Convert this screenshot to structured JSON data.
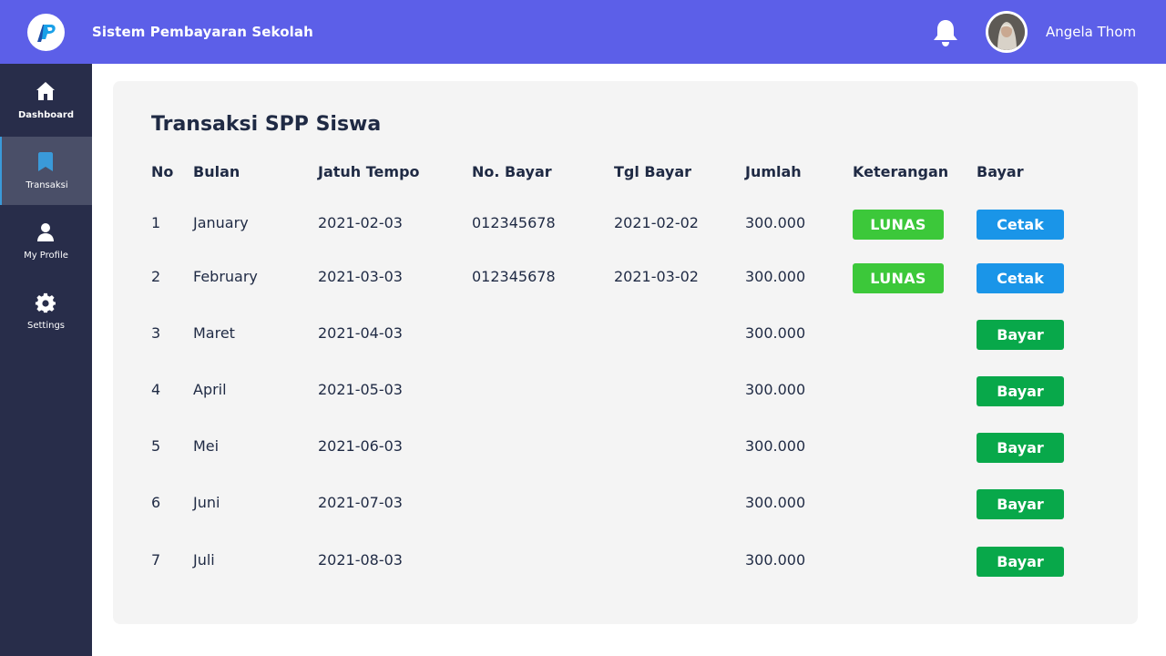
{
  "header": {
    "app_title": "Sistem Pembayaran Sekolah",
    "user_name": "Angela Thom",
    "icons": {
      "logo": "app-logo",
      "bell": "bell-icon",
      "avatar": "user-avatar"
    }
  },
  "sidebar": {
    "items": [
      {
        "label": "Dashboard",
        "icon": "home-icon",
        "active": false
      },
      {
        "label": "Transaksi",
        "icon": "bookmark-icon",
        "active": true
      },
      {
        "label": "My Profile",
        "icon": "user-icon",
        "active": false
      },
      {
        "label": "Settings",
        "icon": "gear-icon",
        "active": false
      }
    ]
  },
  "main": {
    "title": "Transaksi SPP Siswa",
    "columns": [
      "No",
      "Bulan",
      "Jatuh Tempo",
      "No. Bayar",
      "Tgl Bayar",
      "Jumlah",
      "Keterangan",
      "Bayar"
    ],
    "rows": [
      {
        "no": "1",
        "bulan": "January",
        "jatuh_tempo": "2021-02-03",
        "no_bayar": "012345678",
        "tgl_bayar": "2021-02-02",
        "jumlah": "300.000",
        "keterangan": "LUNAS",
        "action": "Cetak"
      },
      {
        "no": "2",
        "bulan": "February",
        "jatuh_tempo": "2021-03-03",
        "no_bayar": "012345678",
        "tgl_bayar": "2021-03-02",
        "jumlah": "300.000",
        "keterangan": "LUNAS",
        "action": "Cetak"
      },
      {
        "no": "3",
        "bulan": "Maret",
        "jatuh_tempo": "2021-04-03",
        "no_bayar": "",
        "tgl_bayar": "",
        "jumlah": "300.000",
        "keterangan": "",
        "action": "Bayar"
      },
      {
        "no": "4",
        "bulan": "April",
        "jatuh_tempo": "2021-05-03",
        "no_bayar": "",
        "tgl_bayar": "",
        "jumlah": "300.000",
        "keterangan": "",
        "action": "Bayar"
      },
      {
        "no": "5",
        "bulan": "Mei",
        "jatuh_tempo": "2021-06-03",
        "no_bayar": "",
        "tgl_bayar": "",
        "jumlah": "300.000",
        "keterangan": "",
        "action": "Bayar"
      },
      {
        "no": "6",
        "bulan": "Juni",
        "jatuh_tempo": "2021-07-03",
        "no_bayar": "",
        "tgl_bayar": "",
        "jumlah": "300.000",
        "keterangan": "",
        "action": "Bayar"
      },
      {
        "no": "7",
        "bulan": "Juli",
        "jatuh_tempo": "2021-08-03",
        "no_bayar": "",
        "tgl_bayar": "",
        "jumlah": "300.000",
        "keterangan": "",
        "action": "Bayar"
      }
    ]
  },
  "colors": {
    "header_bg": "#5c5fe8",
    "sidebar_bg": "#282d4a",
    "sidebar_active_bg": "#4a4f68",
    "lunas": "#3cc83a",
    "cetak": "#1a95e8",
    "bayar": "#08a84a",
    "card_bg": "#f4f4f4",
    "text_dark": "#1f2a44"
  }
}
